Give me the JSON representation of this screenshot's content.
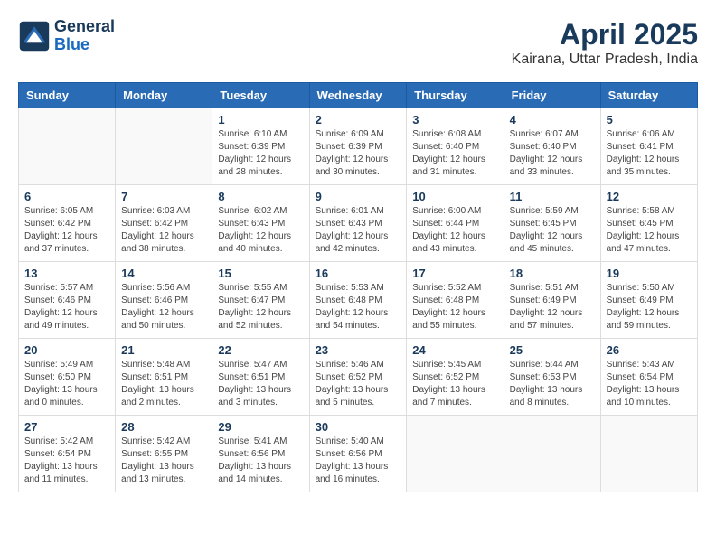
{
  "header": {
    "logo_line1": "General",
    "logo_line2": "Blue",
    "month": "April 2025",
    "location": "Kairana, Uttar Pradesh, India"
  },
  "days_of_week": [
    "Sunday",
    "Monday",
    "Tuesday",
    "Wednesday",
    "Thursday",
    "Friday",
    "Saturday"
  ],
  "weeks": [
    [
      {
        "day": "",
        "info": ""
      },
      {
        "day": "",
        "info": ""
      },
      {
        "day": "1",
        "info": "Sunrise: 6:10 AM\nSunset: 6:39 PM\nDaylight: 12 hours\nand 28 minutes."
      },
      {
        "day": "2",
        "info": "Sunrise: 6:09 AM\nSunset: 6:39 PM\nDaylight: 12 hours\nand 30 minutes."
      },
      {
        "day": "3",
        "info": "Sunrise: 6:08 AM\nSunset: 6:40 PM\nDaylight: 12 hours\nand 31 minutes."
      },
      {
        "day": "4",
        "info": "Sunrise: 6:07 AM\nSunset: 6:40 PM\nDaylight: 12 hours\nand 33 minutes."
      },
      {
        "day": "5",
        "info": "Sunrise: 6:06 AM\nSunset: 6:41 PM\nDaylight: 12 hours\nand 35 minutes."
      }
    ],
    [
      {
        "day": "6",
        "info": "Sunrise: 6:05 AM\nSunset: 6:42 PM\nDaylight: 12 hours\nand 37 minutes."
      },
      {
        "day": "7",
        "info": "Sunrise: 6:03 AM\nSunset: 6:42 PM\nDaylight: 12 hours\nand 38 minutes."
      },
      {
        "day": "8",
        "info": "Sunrise: 6:02 AM\nSunset: 6:43 PM\nDaylight: 12 hours\nand 40 minutes."
      },
      {
        "day": "9",
        "info": "Sunrise: 6:01 AM\nSunset: 6:43 PM\nDaylight: 12 hours\nand 42 minutes."
      },
      {
        "day": "10",
        "info": "Sunrise: 6:00 AM\nSunset: 6:44 PM\nDaylight: 12 hours\nand 43 minutes."
      },
      {
        "day": "11",
        "info": "Sunrise: 5:59 AM\nSunset: 6:45 PM\nDaylight: 12 hours\nand 45 minutes."
      },
      {
        "day": "12",
        "info": "Sunrise: 5:58 AM\nSunset: 6:45 PM\nDaylight: 12 hours\nand 47 minutes."
      }
    ],
    [
      {
        "day": "13",
        "info": "Sunrise: 5:57 AM\nSunset: 6:46 PM\nDaylight: 12 hours\nand 49 minutes."
      },
      {
        "day": "14",
        "info": "Sunrise: 5:56 AM\nSunset: 6:46 PM\nDaylight: 12 hours\nand 50 minutes."
      },
      {
        "day": "15",
        "info": "Sunrise: 5:55 AM\nSunset: 6:47 PM\nDaylight: 12 hours\nand 52 minutes."
      },
      {
        "day": "16",
        "info": "Sunrise: 5:53 AM\nSunset: 6:48 PM\nDaylight: 12 hours\nand 54 minutes."
      },
      {
        "day": "17",
        "info": "Sunrise: 5:52 AM\nSunset: 6:48 PM\nDaylight: 12 hours\nand 55 minutes."
      },
      {
        "day": "18",
        "info": "Sunrise: 5:51 AM\nSunset: 6:49 PM\nDaylight: 12 hours\nand 57 minutes."
      },
      {
        "day": "19",
        "info": "Sunrise: 5:50 AM\nSunset: 6:49 PM\nDaylight: 12 hours\nand 59 minutes."
      }
    ],
    [
      {
        "day": "20",
        "info": "Sunrise: 5:49 AM\nSunset: 6:50 PM\nDaylight: 13 hours\nand 0 minutes."
      },
      {
        "day": "21",
        "info": "Sunrise: 5:48 AM\nSunset: 6:51 PM\nDaylight: 13 hours\nand 2 minutes."
      },
      {
        "day": "22",
        "info": "Sunrise: 5:47 AM\nSunset: 6:51 PM\nDaylight: 13 hours\nand 3 minutes."
      },
      {
        "day": "23",
        "info": "Sunrise: 5:46 AM\nSunset: 6:52 PM\nDaylight: 13 hours\nand 5 minutes."
      },
      {
        "day": "24",
        "info": "Sunrise: 5:45 AM\nSunset: 6:52 PM\nDaylight: 13 hours\nand 7 minutes."
      },
      {
        "day": "25",
        "info": "Sunrise: 5:44 AM\nSunset: 6:53 PM\nDaylight: 13 hours\nand 8 minutes."
      },
      {
        "day": "26",
        "info": "Sunrise: 5:43 AM\nSunset: 6:54 PM\nDaylight: 13 hours\nand 10 minutes."
      }
    ],
    [
      {
        "day": "27",
        "info": "Sunrise: 5:42 AM\nSunset: 6:54 PM\nDaylight: 13 hours\nand 11 minutes."
      },
      {
        "day": "28",
        "info": "Sunrise: 5:42 AM\nSunset: 6:55 PM\nDaylight: 13 hours\nand 13 minutes."
      },
      {
        "day": "29",
        "info": "Sunrise: 5:41 AM\nSunset: 6:56 PM\nDaylight: 13 hours\nand 14 minutes."
      },
      {
        "day": "30",
        "info": "Sunrise: 5:40 AM\nSunset: 6:56 PM\nDaylight: 13 hours\nand 16 minutes."
      },
      {
        "day": "",
        "info": ""
      },
      {
        "day": "",
        "info": ""
      },
      {
        "day": "",
        "info": ""
      }
    ]
  ]
}
